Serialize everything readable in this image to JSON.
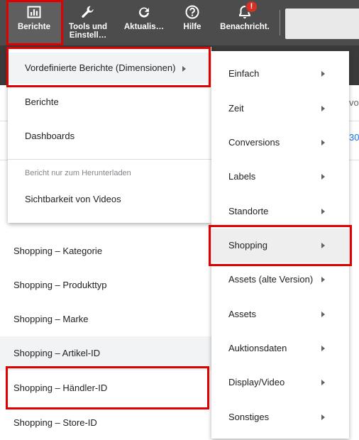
{
  "toolbar": {
    "buttons": [
      {
        "label": "Berichte",
        "icon": "reports-icon"
      },
      {
        "label": "Tools und Einstell…",
        "icon": "wrench-icon"
      },
      {
        "label": "Aktualis…",
        "icon": "refresh-icon"
      },
      {
        "label": "Hilfe",
        "icon": "help-icon"
      },
      {
        "label": "Benachricht.",
        "icon": "bell-icon",
        "badge": "!"
      }
    ]
  },
  "background": {
    "edge_texts": [
      "vo",
      "30"
    ],
    "list": [
      "Shopping – Kategorie",
      "Shopping – Produkttyp",
      "Shopping – Marke",
      "Shopping – Artikel-ID",
      "Shopping – Händler-ID",
      "Shopping – Store-ID"
    ]
  },
  "menu": {
    "predefined": "Vordefinierte Berichte (Dimensionen)",
    "reports": "Berichte",
    "dashboards": "Dashboards",
    "download_header": "Bericht nur zum Herunterladen",
    "video_visibility": "Sichtbarkeit von Videos"
  },
  "submenu": {
    "items": [
      "Einfach",
      "Zeit",
      "Conversions",
      "Labels",
      "Standorte",
      "Shopping",
      "Assets (alte Version)",
      "Assets",
      "Auktionsdaten",
      "Display/Video",
      "Sonstiges"
    ]
  },
  "colors": {
    "toolbar_bg": "#4c4c4c",
    "highlight": "#e00000",
    "badge": "#d93025",
    "link": "#1a73e8"
  }
}
